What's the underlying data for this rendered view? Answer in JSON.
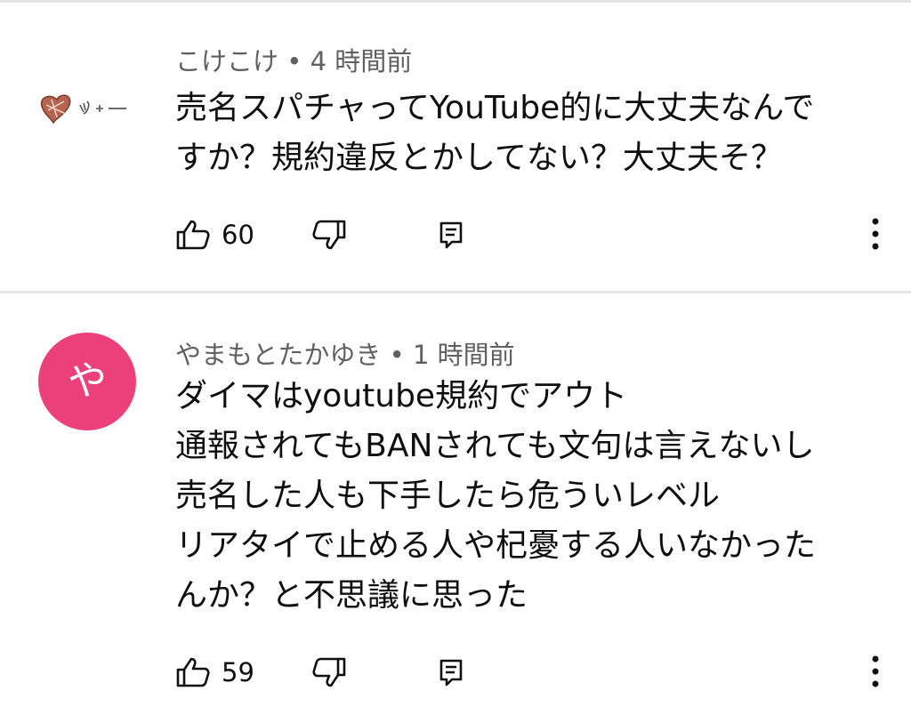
{
  "comments": [
    {
      "author": "こけこけ",
      "time": "4 時間前",
      "avatar_type": "image",
      "avatar_icon": "heart-doodle-avatar",
      "lines": [
        "売名スパチャってYouTube的に大丈夫なんで",
        "すか？規約違反とかしてない？大丈夫そ？"
      ],
      "likes": "60"
    },
    {
      "author": "やまもとたかゆき",
      "time": "1 時間前",
      "avatar_type": "letter",
      "avatar_letter": "や",
      "avatar_color": "#ec407a",
      "lines": [
        "ダイマはyoutube規約でアウト",
        "通報されてもBANされても文句は言えないし",
        "売名した人も下手したら危ういレベル",
        "リアタイで止める人や杞憂する人いなかった",
        "んか？と不思議に思った"
      ],
      "likes": "59"
    }
  ],
  "separator": "•",
  "icons": {
    "like": "thumb-up-icon",
    "dislike": "thumb-down-icon",
    "reply": "reply-icon",
    "more": "more-vert-icon"
  },
  "colors": {
    "meta_text": "#606060",
    "divider": "#e5e5e5"
  }
}
